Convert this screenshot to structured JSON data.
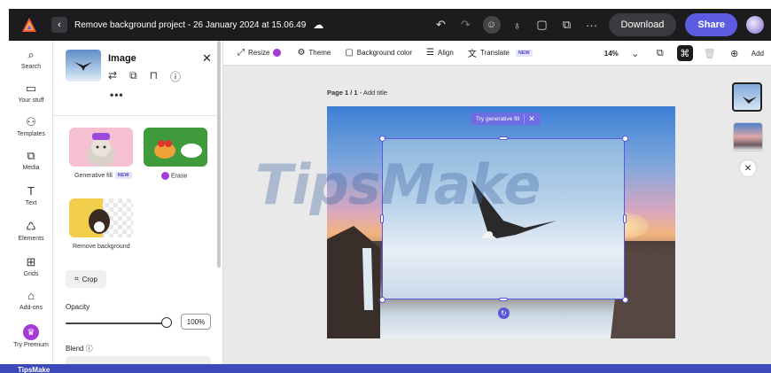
{
  "titlebar": {
    "doc_title": "Remove background project - 26 January 2024 at 15.06.49",
    "download_label": "Download",
    "share_label": "Share",
    "icons": [
      "undo-icon",
      "redo-icon",
      "collaborator-icon",
      "lightbulb-icon",
      "comment-icon",
      "chat-icon",
      "more-icon"
    ]
  },
  "rail": {
    "items": [
      {
        "label": "Search",
        "icon": "⌕"
      },
      {
        "label": "Your stuff",
        "icon": "▭"
      },
      {
        "label": "Templates",
        "icon": "⚇"
      },
      {
        "label": "Media",
        "icon": "⧉"
      },
      {
        "label": "Text",
        "icon": "T"
      },
      {
        "label": "Elements",
        "icon": "♺"
      },
      {
        "label": "Grids",
        "icon": "⊞"
      },
      {
        "label": "Add-ons",
        "icon": "⌂"
      },
      {
        "label": "Try Premium",
        "icon": "♛"
      }
    ]
  },
  "panel": {
    "title": "Image",
    "more": "•••",
    "generative_fill_label": "Generative fill",
    "new_badge": "NEW",
    "erase_label": "Erase",
    "remove_background_label": "Remove background",
    "crop_label": "Crop",
    "opacity_label": "Opacity",
    "opacity_value": "100%",
    "blend_label": "Blend ⓘ"
  },
  "toolbar": {
    "resize_label": "Resize",
    "theme_label": "Theme",
    "background_color_label": "Background color",
    "align_label": "Align",
    "translate_label": "Translate",
    "translate_badge": "NEW",
    "zoom_value": "14%",
    "add_label": "Add"
  },
  "canvas": {
    "page_label_bold": "Page 1 / 1",
    "page_label_rest": " - Add title",
    "genfill_pill": "Try generative fill",
    "watermark": "TipsMake"
  },
  "bottom": {
    "brand": "TipsMake"
  },
  "colors": {
    "accent": "#5c5ce0",
    "premium": "#a43bd6",
    "titlebar_bg": "#1c1c1f",
    "selection": "#5a58d6"
  }
}
